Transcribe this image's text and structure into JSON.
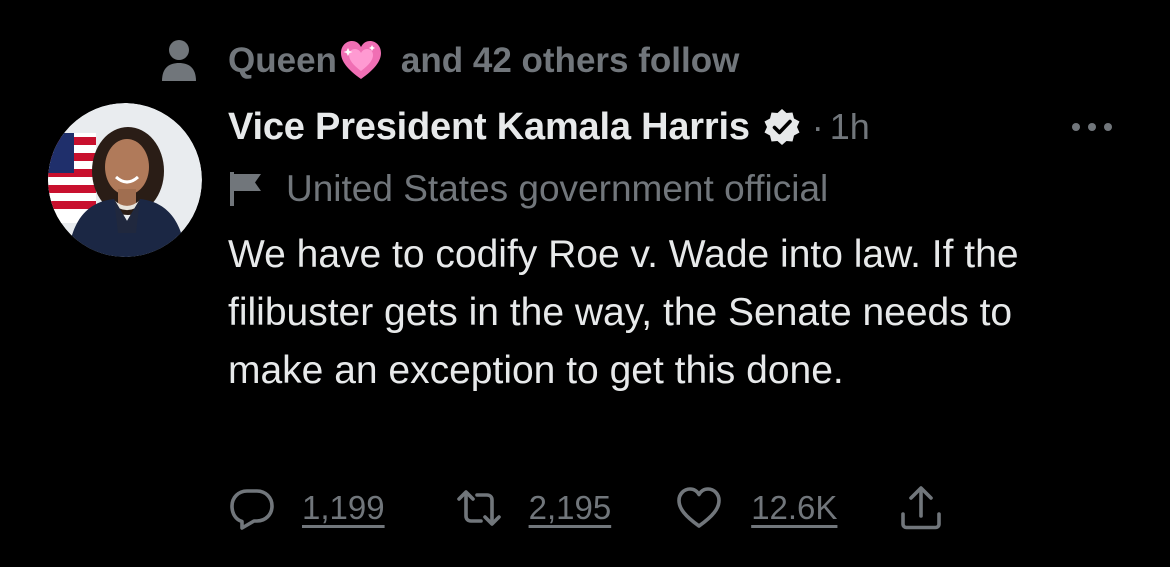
{
  "social_context": {
    "name": "Queen",
    "emoji": "sparkling-heart-emoji",
    "suffix": "and 42 others follow",
    "icon": "person-icon"
  },
  "author": {
    "display_name": "Vice President Kamala Harris",
    "verified_icon": "verified-badge-icon",
    "separator": "·",
    "timestamp": "1h",
    "label_icon": "flag-icon",
    "label": "United States government official",
    "avatar": "profile-photo"
  },
  "tweet": {
    "text": "We have to codify Roe v. Wade into law. If the filibuster gets in the way, the Senate needs to make an exception to get this done."
  },
  "actions": {
    "reply_count": "1,199",
    "retweet_count": "2,195",
    "like_count": "12.6K",
    "reply_icon": "reply-icon",
    "retweet_icon": "retweet-icon",
    "like_icon": "heart-icon",
    "share_icon": "share-icon",
    "more_icon": "more-icon"
  },
  "colors": {
    "background": "#000000",
    "primary_text": "#e7e9ea",
    "secondary_text": "#71767b",
    "heart_emoji": "#f06fb4"
  }
}
